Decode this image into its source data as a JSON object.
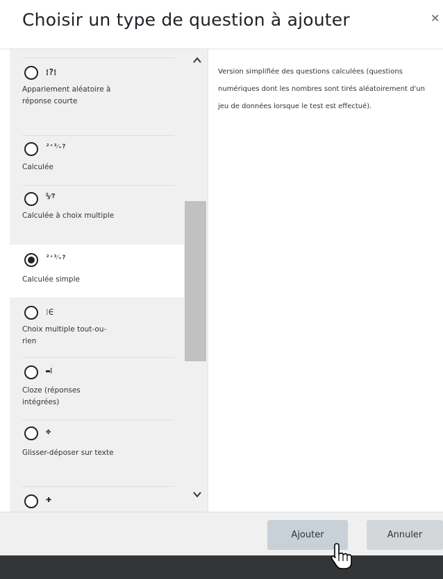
{
  "dialog": {
    "title": "Choisir un type de question à ajouter",
    "close_glyph": "×"
  },
  "question_types": [
    {
      "icon": "⁞?⁞",
      "icon_name": "random-shortanswer-match-icon",
      "label": "Appariement aléatoire à réponse courte",
      "selected": false
    },
    {
      "icon": "²⁺³⁄₌?",
      "icon_name": "calculated-icon",
      "label": "Calculée",
      "selected": false
    },
    {
      "icon": "⅔⁄?",
      "icon_name": "calculated-multichoice-icon",
      "label": "Calculée à choix multiple",
      "selected": false
    },
    {
      "icon": "²⁺³⁄₌?",
      "icon_name": "calculated-simple-icon",
      "label": "Calculée simple",
      "selected": true
    },
    {
      "icon": "⁝∈",
      "icon_name": "multichoice-all-or-nothing-icon",
      "label": "Choix multiple tout-ou-rien",
      "selected": false
    },
    {
      "icon": "▬⁞",
      "icon_name": "cloze-icon",
      "label": "Cloze (réponses intégrées)",
      "selected": false
    },
    {
      "icon": "✥",
      "icon_name": "drag-drop-text-icon",
      "label": "Glisser-déposer sur texte",
      "selected": false
    },
    {
      "icon": "✚",
      "icon_name": "drag-drop-image-icon",
      "label": "",
      "selected": false
    }
  ],
  "description": "Version simplifiée des questions calculées (questions numériques dont les nombres sont tirés aléatoirement d'un jeu de données lorsque le test est effectué).",
  "footer": {
    "add_label": "Ajouter",
    "cancel_label": "Annuler"
  },
  "colors": {
    "list_bg": "#f0f0f0",
    "selected_bg": "#ffffff",
    "primary_button": "#c8d0d8",
    "secondary_button": "#d4d7da",
    "bottom_bar": "#333537"
  }
}
